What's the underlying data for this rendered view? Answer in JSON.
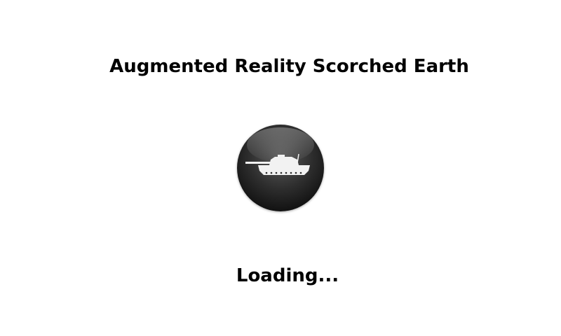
{
  "app": {
    "title": "Augmented Reality Scorched Earth",
    "logo_icon": "tank-icon"
  },
  "status": {
    "loading_text": "Loading..."
  },
  "colors": {
    "background": "#ffffff",
    "text": "#000000",
    "logo_dark": "#141414",
    "tank": "#f2f2f2"
  }
}
